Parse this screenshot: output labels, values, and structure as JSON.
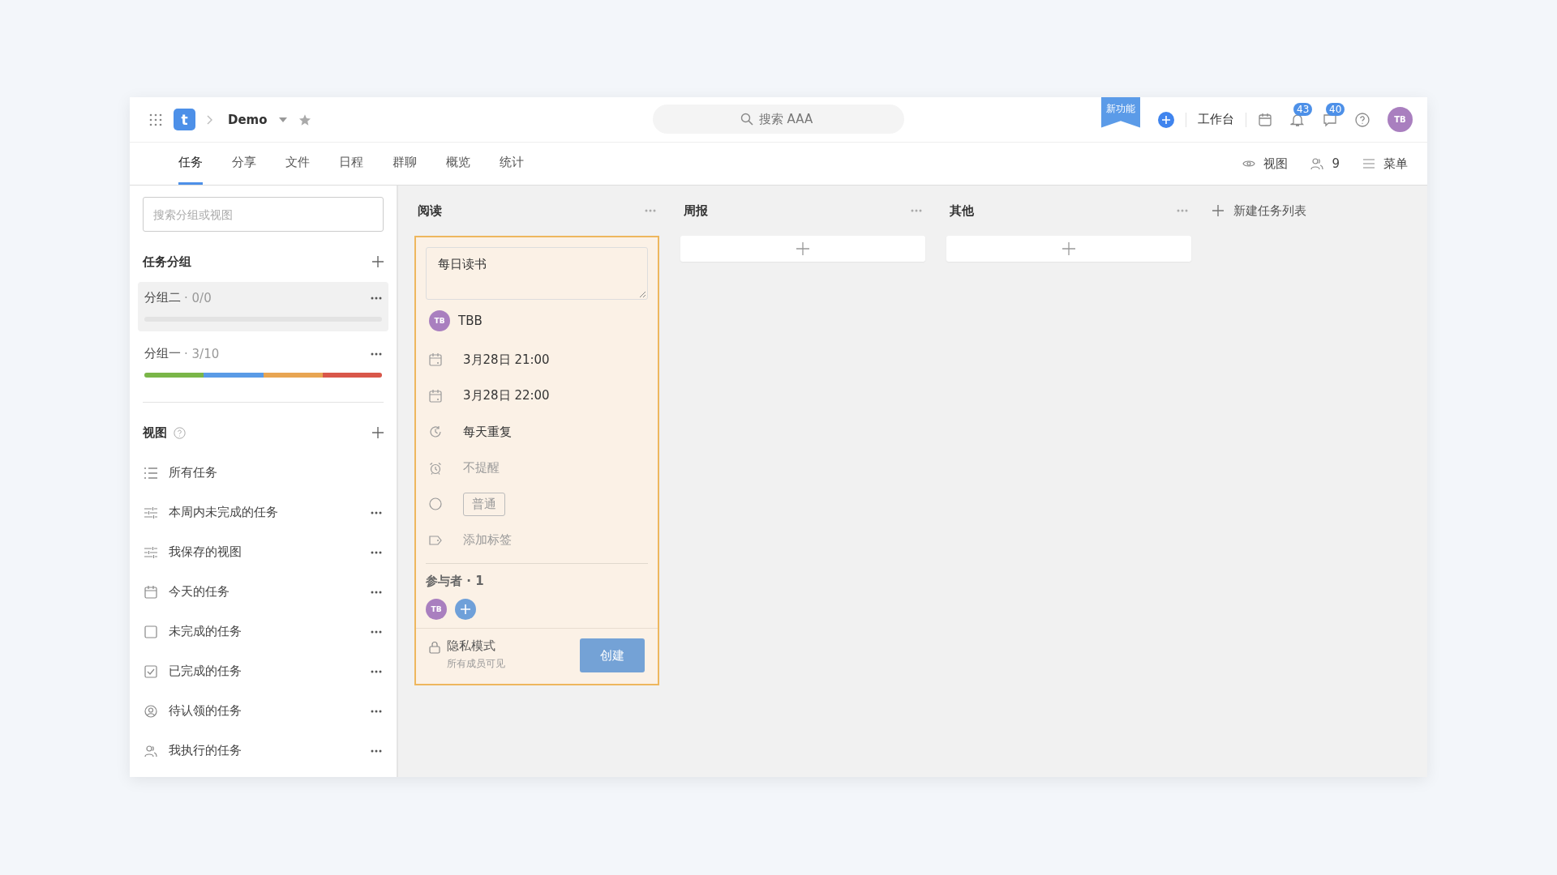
{
  "header": {
    "logo": "t",
    "project": "Demo",
    "search": {
      "placeholder": "搜索 AAA"
    },
    "ribbon": "新功能",
    "workbench": "工作台",
    "notifications": "43",
    "messages": "40",
    "avatar": "TB"
  },
  "tabs": [
    {
      "label": "任务",
      "selected": true
    },
    {
      "label": "分享",
      "selected": false
    },
    {
      "label": "文件",
      "selected": false
    },
    {
      "label": "日程",
      "selected": false
    },
    {
      "label": "群聊",
      "selected": false
    },
    {
      "label": "概览",
      "selected": false
    },
    {
      "label": "统计",
      "selected": false
    }
  ],
  "toolbar": {
    "view": "视图",
    "members": "9",
    "menu": "菜单"
  },
  "sidebar": {
    "search": {
      "placeholder": "搜索分组或视图"
    },
    "groups_title": "任务分组",
    "groups": [
      {
        "name": "分组二",
        "count": "· 0/0",
        "selected": true
      },
      {
        "name": "分组一",
        "count": "· 3/10",
        "selected": false,
        "segments": [
          {
            "color": "#7ab648"
          },
          {
            "color": "#5a9be6"
          },
          {
            "color": "#e8a552"
          },
          {
            "color": "#d9574a"
          }
        ]
      }
    ],
    "views_title": "视图",
    "views": [
      {
        "kind": "list",
        "label": "所有任务",
        "more": false
      },
      {
        "kind": "filter",
        "label": "本周内未完成的任务",
        "more": true
      },
      {
        "kind": "filter",
        "label": "我保存的视图",
        "more": true
      },
      {
        "kind": "calendar",
        "label": "今天的任务",
        "more": true
      },
      {
        "kind": "box",
        "label": "未完成的任务",
        "more": true
      },
      {
        "kind": "checked",
        "label": "已完成的任务",
        "more": true
      },
      {
        "kind": "person",
        "label": "待认领的任务",
        "more": true
      },
      {
        "kind": "people",
        "label": "我执行的任务",
        "more": true
      }
    ]
  },
  "columns": [
    {
      "title": "阅读",
      "card": {
        "title": "每日读书",
        "assignee_avatar": "TB",
        "assignee": "TBB",
        "fields": [
          {
            "kind": "date",
            "text": "3月28日 21:00",
            "muted": false
          },
          {
            "kind": "date",
            "text": "3月28日 22:00",
            "muted": false
          },
          {
            "kind": "repeat",
            "text": "每天重复",
            "muted": false
          },
          {
            "kind": "reminder",
            "text": "不提醒",
            "muted": true
          },
          {
            "kind": "priority",
            "text": "普通",
            "muted": true
          },
          {
            "kind": "tag",
            "text": "添加标签",
            "muted": true
          }
        ],
        "participants": "参与者 · 1",
        "participant_avatars": [
          "TB"
        ],
        "privacy": "隐私模式",
        "privacy_note": "所有成员可见",
        "create": "创建"
      }
    },
    {
      "title": "周报"
    },
    {
      "title": "其他"
    }
  ],
  "new_list": "新建任务列表"
}
